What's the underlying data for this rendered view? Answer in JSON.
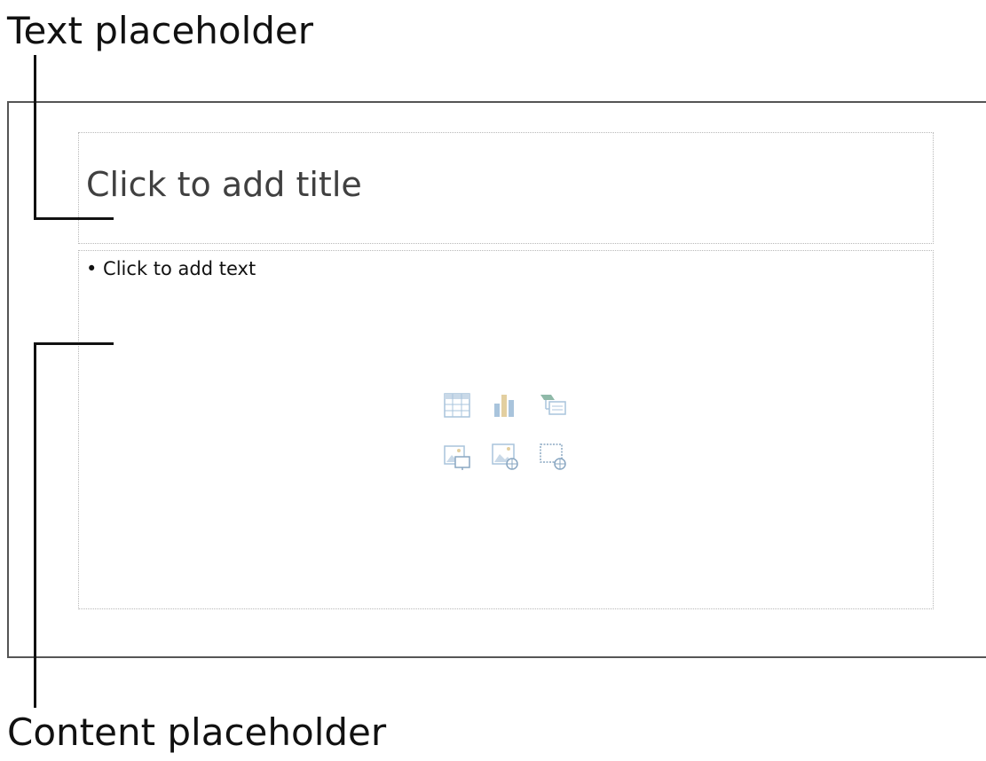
{
  "callouts": {
    "text_placeholder": "Text placeholder",
    "content_placeholder": "Content placeholder"
  },
  "slide": {
    "title_prompt": "Click to add title",
    "body_prompt": "• Click to add text",
    "content_icons": [
      "insert-table-icon",
      "insert-chart-icon",
      "insert-smartart-icon",
      "insert-picture-icon",
      "insert-online-picture-icon",
      "insert-video-icon"
    ]
  },
  "colors": {
    "slide_border": "#555555",
    "placeholder_border": "#b8b8b8",
    "leader_line": "#111111",
    "icon_tint": "#a9c4dc"
  }
}
